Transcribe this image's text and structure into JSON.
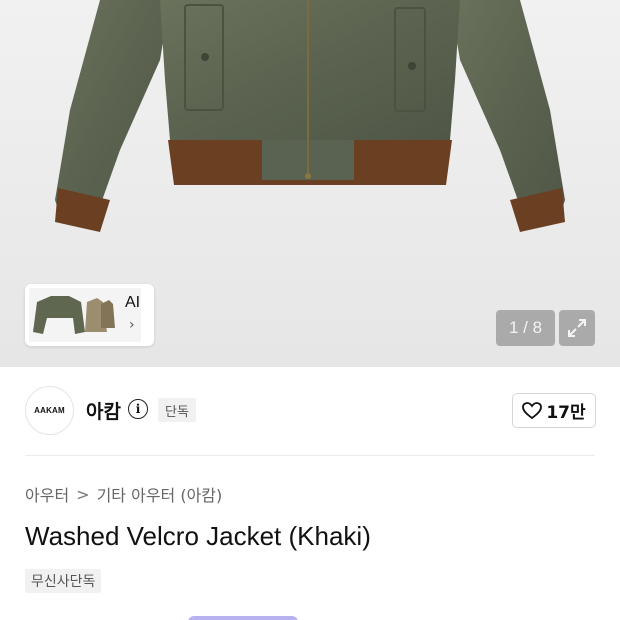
{
  "gallery": {
    "counter": "1 / 8",
    "ai_label": "AI",
    "ai_chevron": "›",
    "expand_icon": "expand-icon"
  },
  "brand": {
    "logo_text": "AAKAM",
    "name": "아캄",
    "info_icon": "i",
    "badge": "단독"
  },
  "like": {
    "icon": "heart-icon",
    "count": "17만"
  },
  "breadcrumb": {
    "items": [
      "아우터",
      "기타 아우터 (아캄)"
    ],
    "separator": ">"
  },
  "product": {
    "title": "Washed Velcro Jacket (Khaki)",
    "tag": "무신사단독"
  },
  "colors": {
    "jacket_body": "#5f6751",
    "jacket_rib": "#6b3f22",
    "accent_pill": "#b9b2f0"
  }
}
